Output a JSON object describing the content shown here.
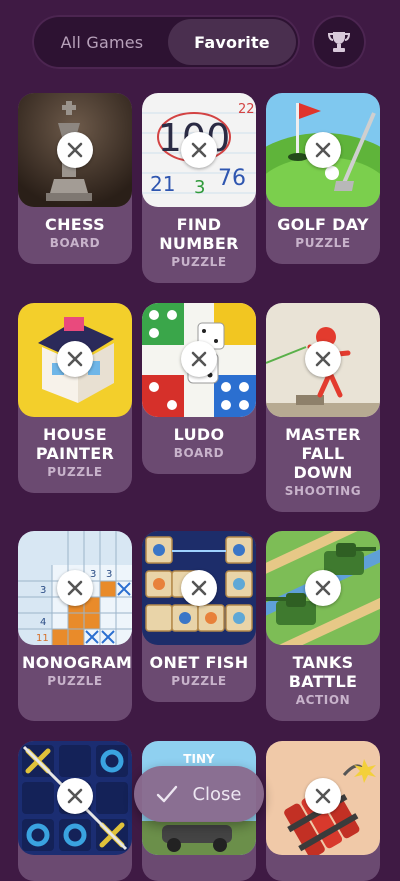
{
  "tabs": {
    "all": "All Games",
    "favorite": "Favorite"
  },
  "icons": {
    "trophy": "trophy-icon",
    "remove": "close-x-icon",
    "check": "check-icon"
  },
  "games": [
    {
      "title": "CHESS",
      "category": "BOARD"
    },
    {
      "title": "FIND NUMBER",
      "category": "PUZZLE"
    },
    {
      "title": "GOLF DAY",
      "category": "PUZZLE"
    },
    {
      "title": "HOUSE PAINTER",
      "category": "PUZZLE"
    },
    {
      "title": "LUDO",
      "category": "BOARD"
    },
    {
      "title": "MASTER FALL DOWN",
      "category": "SHOOTING"
    },
    {
      "title": "NONOGRAM",
      "category": "PUZZLE"
    },
    {
      "title": "ONET FISH",
      "category": "PUZZLE"
    },
    {
      "title": "TANKS BATTLE",
      "category": "ACTION"
    },
    {
      "title": "",
      "category": ""
    },
    {
      "title": "",
      "category": ""
    },
    {
      "title": "",
      "category": ""
    }
  ],
  "thumb_text": {
    "find_number_big": "100",
    "find_number_nums": [
      "22",
      "21",
      "3",
      "76"
    ],
    "nonogram_nums": [
      "3",
      "3",
      "3",
      "4",
      "11"
    ],
    "row4_center_banner": "TINY"
  },
  "close_button": {
    "label": "Close"
  },
  "colors": {
    "background": "#3f1a44",
    "card": "#6b4a71",
    "category_text": "#c8b3cb"
  }
}
